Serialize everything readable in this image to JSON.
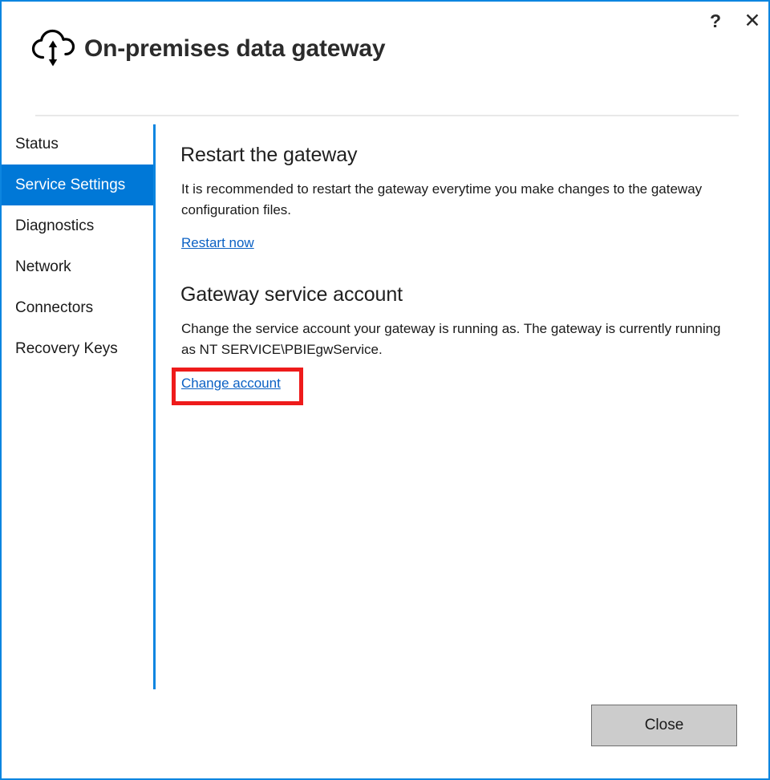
{
  "window": {
    "title": "On-premises data gateway",
    "icon": "cloud-up-down-arrow-icon",
    "border_color": "#0c85e0",
    "help_label": "?",
    "close_label": "✕"
  },
  "sidebar": {
    "selected_index": 1,
    "selected_color": "#0078d7",
    "items": [
      {
        "label": "Status"
      },
      {
        "label": "Service Settings"
      },
      {
        "label": "Diagnostics"
      },
      {
        "label": "Network"
      },
      {
        "label": "Connectors"
      },
      {
        "label": "Recovery Keys"
      }
    ]
  },
  "content": {
    "sections": [
      {
        "title": "Restart the gateway",
        "body": "It is recommended to restart the gateway everytime you make changes to the gateway configuration files.",
        "link": "Restart now"
      },
      {
        "title": "Gateway service account",
        "body": "Change the service account your gateway is running as. The gateway is currently running as NT SERVICE\\PBIEgwService.",
        "link": "Change account"
      }
    ],
    "link_color": "#0b61c4"
  },
  "annotation": {
    "target": "Change account",
    "color": "#ee1b1b"
  },
  "footer": {
    "close_label": "Close"
  }
}
